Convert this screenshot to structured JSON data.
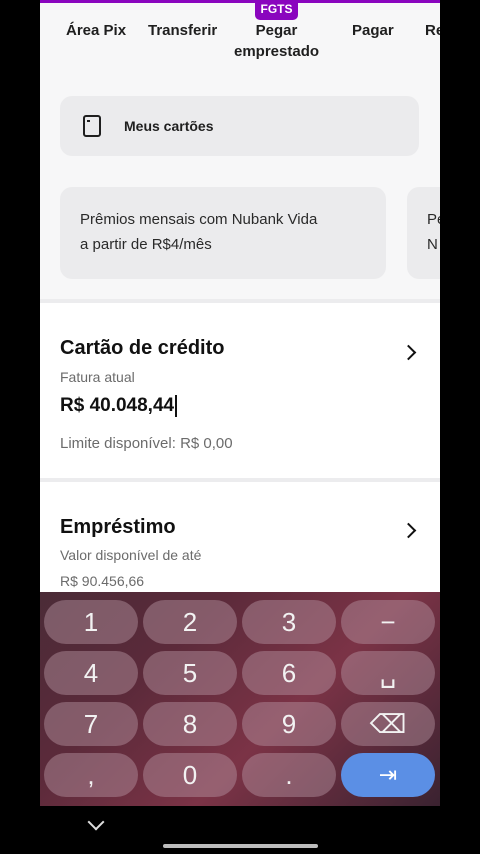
{
  "shortcuts": {
    "items": [
      {
        "label": "Área Pix"
      },
      {
        "label": "Transferir"
      },
      {
        "label": "Pegar\nemprestado"
      },
      {
        "label": "Pagar"
      },
      {
        "label": "Re"
      }
    ],
    "badge": "FGTS"
  },
  "my_cards": {
    "label": "Meus cartões",
    "icon": "card-icon"
  },
  "promos": [
    {
      "text": "Prêmios mensais com Nubank Vida\na partir de R$4/mês"
    },
    {
      "text": "Pe\nN"
    }
  ],
  "credit_card": {
    "title": "Cartão de crédito",
    "invoice_label": "Fatura atual",
    "invoice_value": "R$ 40.048,44",
    "limit_label": "Limite disponível:",
    "limit_value": "R$ 0,00"
  },
  "loan": {
    "title": "Empréstimo",
    "available_label": "Valor disponível de até",
    "available_value": "R$ 90.456,66"
  },
  "keyboard": {
    "keys": [
      "1",
      "2",
      "3",
      "−",
      "4",
      "5",
      "6",
      "␣",
      "7",
      "8",
      "9",
      "⌫",
      ",",
      "0",
      ".",
      "⇥"
    ]
  },
  "colors": {
    "brand": "#8a05be",
    "enter_key": "#5b8fe5"
  }
}
